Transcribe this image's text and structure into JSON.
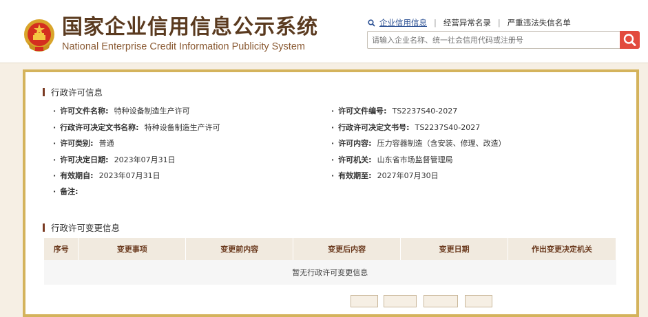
{
  "header": {
    "brand_cn": "国家企业信用信息公示系统",
    "brand_en": "National Enterprise Credit Information Publicity System",
    "links": [
      "企业信用信息",
      "经营异常名录",
      "严重违法失信名单"
    ],
    "search_placeholder": "请输入企业名称、统一社会信用代码或注册号"
  },
  "license": {
    "title": "行政许可信息",
    "fields": [
      {
        "label": "许可文件名称:",
        "value": "特种设备制造生产许可"
      },
      {
        "label": "许可文件编号:",
        "value": "TS2237S40-2027"
      },
      {
        "label": "行政许可决定文书名称:",
        "value": "特种设备制造生产许可"
      },
      {
        "label": "行政许可决定文书号:",
        "value": "TS2237S40-2027"
      },
      {
        "label": "许可类别:",
        "value": "普通"
      },
      {
        "label": "许可内容:",
        "value": "压力容器制造（含安装、修理、改造）"
      },
      {
        "label": "许可决定日期:",
        "value": "2023年07月31日"
      },
      {
        "label": "许可机关:",
        "value": "山东省市场监督管理局"
      },
      {
        "label": "有效期自:",
        "value": "2023年07月31日"
      },
      {
        "label": "有效期至:",
        "value": "2027年07月30日"
      },
      {
        "label": "备注:",
        "value": ""
      }
    ]
  },
  "changes": {
    "title": "行政许可变更信息",
    "columns": [
      "序号",
      "变更事项",
      "变更前内容",
      "变更后内容",
      "变更日期",
      "作出变更决定机关"
    ],
    "empty_text": "暂无行政许可变更信息"
  },
  "colors": {
    "panel_border": "#d4b35c",
    "brand": "#5a3a1f",
    "search_button": "#e24b3e"
  }
}
